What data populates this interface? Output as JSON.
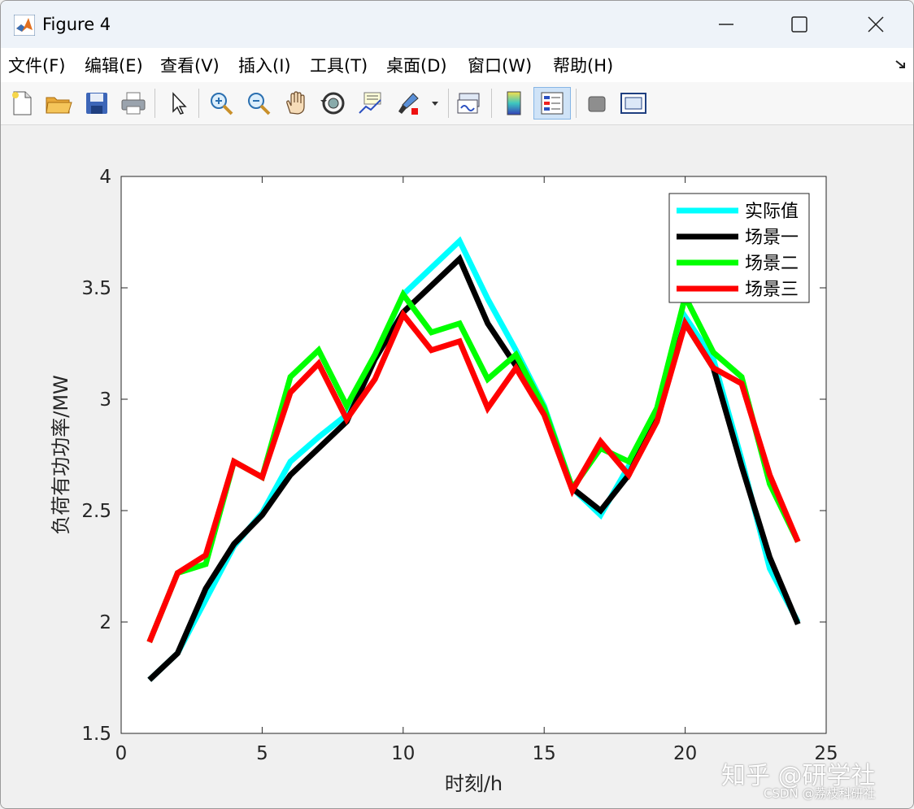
{
  "window": {
    "title": "Figure 4"
  },
  "menu": [
    {
      "label": "文件(F)",
      "key": "file"
    },
    {
      "label": "编辑(E)",
      "key": "edit"
    },
    {
      "label": "查看(V)",
      "key": "view"
    },
    {
      "label": "插入(I)",
      "key": "insert"
    },
    {
      "label": "工具(T)",
      "key": "tools"
    },
    {
      "label": "桌面(D)",
      "key": "desktop"
    },
    {
      "label": "窗口(W)",
      "key": "window"
    },
    {
      "label": "帮助(H)",
      "key": "help"
    }
  ],
  "toolbar": [
    {
      "icon": "new-figure-icon"
    },
    {
      "icon": "open-file-icon"
    },
    {
      "icon": "save-icon"
    },
    {
      "icon": "print-icon"
    },
    {
      "icon": "select-pointer-icon"
    },
    {
      "icon": "zoom-in-icon"
    },
    {
      "icon": "zoom-out-icon"
    },
    {
      "icon": "pan-hand-icon"
    },
    {
      "icon": "rotate-3d-icon"
    },
    {
      "icon": "data-cursor-icon"
    },
    {
      "icon": "brush-icon"
    },
    {
      "icon": "link-plot-icon"
    },
    {
      "icon": "colorbar-icon"
    },
    {
      "icon": "legend-icon"
    },
    {
      "icon": "hide-tools-icon"
    },
    {
      "icon": "show-tools-icon"
    }
  ],
  "watermark": {
    "main": "知乎 @研学社",
    "sub": "CSDN @荔枝科研社"
  },
  "chart_data": {
    "type": "line",
    "xlabel": "时刻/h",
    "ylabel": "负荷有功功率/MW",
    "xlim": [
      0,
      25
    ],
    "ylim": [
      1.5,
      4
    ],
    "xticks": [
      "0",
      "5",
      "10",
      "15",
      "20",
      "25"
    ],
    "yticks": [
      "1.5",
      "2",
      "2.5",
      "3",
      "3.5",
      "4"
    ],
    "legend_position": "top-right",
    "grid": false,
    "x": [
      1,
      2,
      3,
      4,
      5,
      6,
      7,
      8,
      9,
      10,
      11,
      12,
      13,
      14,
      15,
      16,
      17,
      18,
      19,
      20,
      21,
      22,
      23,
      24
    ],
    "series": [
      {
        "name": "实际值",
        "color": "#00ffff",
        "values": [
          1.74,
          1.86,
          2.1,
          2.34,
          2.49,
          2.72,
          2.83,
          2.93,
          3.19,
          3.47,
          3.59,
          3.71,
          3.45,
          3.22,
          2.97,
          2.6,
          2.48,
          2.7,
          2.94,
          3.37,
          3.18,
          2.73,
          2.24,
          2.0
        ]
      },
      {
        "name": "场景一",
        "color": "#000000",
        "values": [
          1.74,
          1.86,
          2.15,
          2.35,
          2.48,
          2.66,
          2.78,
          2.9,
          3.18,
          3.39,
          3.51,
          3.63,
          3.34,
          3.15,
          2.95,
          2.6,
          2.5,
          2.66,
          2.93,
          3.34,
          3.14,
          2.7,
          2.29,
          1.99
        ]
      },
      {
        "name": "场景二",
        "color": "#00ff00",
        "values": [
          1.91,
          2.22,
          2.26,
          2.72,
          2.65,
          3.1,
          3.22,
          2.97,
          3.2,
          3.47,
          3.3,
          3.34,
          3.09,
          3.2,
          2.96,
          2.6,
          2.78,
          2.72,
          2.96,
          3.46,
          3.21,
          3.1,
          2.62,
          2.36
        ]
      },
      {
        "name": "场景三",
        "color": "#ff0000",
        "values": [
          1.91,
          2.22,
          2.3,
          2.72,
          2.65,
          3.03,
          3.16,
          2.91,
          3.09,
          3.38,
          3.22,
          3.26,
          2.96,
          3.14,
          2.93,
          2.59,
          2.81,
          2.66,
          2.9,
          3.34,
          3.14,
          3.07,
          2.66,
          2.36
        ]
      }
    ]
  }
}
